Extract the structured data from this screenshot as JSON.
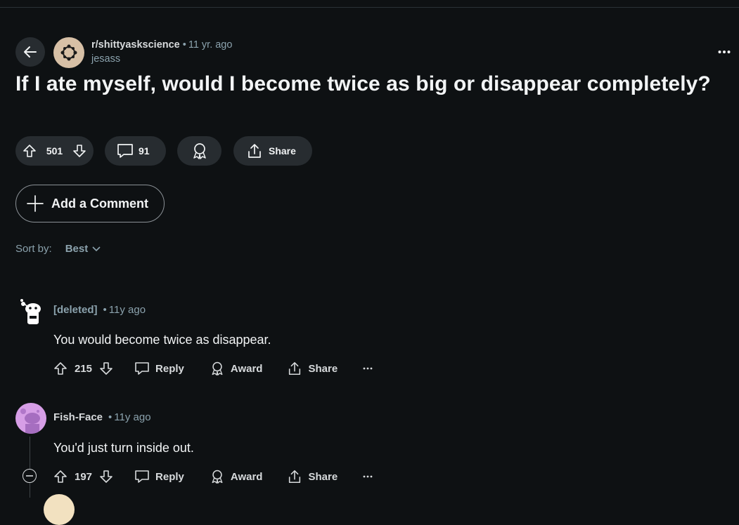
{
  "post": {
    "subreddit": "r/shittyaskscience",
    "time": "11 yr. ago",
    "author": "jesass",
    "title": "If I ate myself, would I become twice as big or disappear completely?",
    "votes": "501",
    "comments": "91",
    "share_label": "Share"
  },
  "add_comment_label": "Add a Comment",
  "sort": {
    "label": "Sort by:",
    "value": "Best"
  },
  "comments": [
    {
      "author": "[deleted]",
      "time": "11y ago",
      "body": "You would become twice as disappear.",
      "votes": "215",
      "reply": "Reply",
      "award": "Award",
      "share": "Share"
    },
    {
      "author": "Fish-Face",
      "time": "11y ago",
      "body": "You'd just turn inside out.",
      "votes": "197",
      "reply": "Reply",
      "award": "Award",
      "share": "Share"
    }
  ],
  "colors": {
    "background": "#0e1113",
    "pill": "#272c30",
    "muted_text": "#8ba2ad",
    "avatar_fish_face": "#d69ee6",
    "subreddit_icon_bg": "#d7c0a6"
  }
}
